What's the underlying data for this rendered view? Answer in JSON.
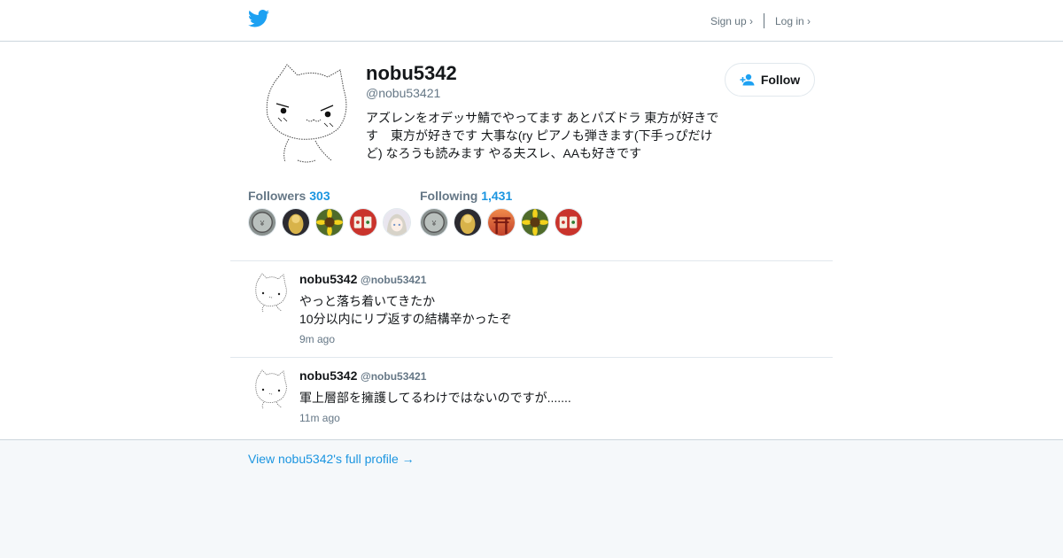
{
  "header": {
    "logo_icon": "twitter-bird-icon",
    "signup_label": "Sign up ›",
    "login_label": "Log in ›"
  },
  "profile": {
    "name": "nobu5342",
    "handle": "@nobu53421",
    "bio": "アズレンをオデッサ鯖でやってます あとパズドラ 東方が好きです　東方が好きです 大事な(ry ピアノも弾きます(下手っぴだけど) なろうも読みます やる夫スレ、AAも好きです",
    "follow_label": "Follow"
  },
  "followers": {
    "label": "Followers",
    "count": "303",
    "avatars": [
      "coin-avatar",
      "gold-statue-avatar",
      "sunflower-avatar",
      "mahjong-tile-avatar",
      "anime-girl-avatar"
    ]
  },
  "following": {
    "label": "Following",
    "count": "1,431",
    "avatars": [
      "coin-avatar",
      "gold-statue-avatar",
      "torii-gate-avatar",
      "sunflower-avatar",
      "mahjong-tile-avatar"
    ]
  },
  "tweets": [
    {
      "name": "nobu5342",
      "handle": "@nobu53421",
      "text": "やっと落ち着いてきたか\n10分以内にリプ返すの結構辛かったぞ",
      "time": "9m ago"
    },
    {
      "name": "nobu5342",
      "handle": "@nobu53421",
      "text": "軍上層部を擁護してるわけではないのですが.......",
      "time": "11m ago"
    }
  ],
  "footer": {
    "full_profile_link": "View nobu5342's full profile →"
  },
  "colors": {
    "accent": "#1b95e0",
    "bird": "#1da1f2",
    "muted": "#657786",
    "border": "#e1e8ed",
    "page_bg": "#f5f8fa"
  }
}
